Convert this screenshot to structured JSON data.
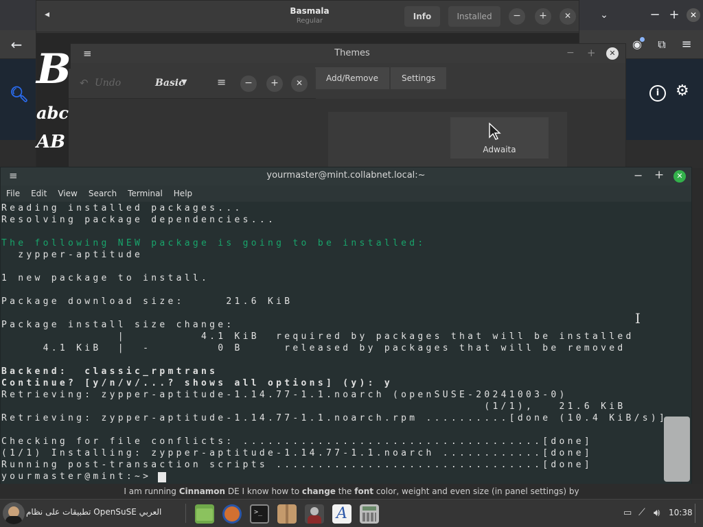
{
  "font_viewer": {
    "title": "Basmala",
    "subtitle": "Regular",
    "info_label": "Info",
    "installed_label": "Installed",
    "sample_big": "B",
    "sample_lower": "abcde",
    "sample_upper": "AB"
  },
  "themes": {
    "title": "Themes",
    "tabs": [
      "Add/Remove",
      "Settings"
    ],
    "theme_card": "Adwaita"
  },
  "mini": {
    "undo_label": "Undo",
    "mode_label": "Basic"
  },
  "terminal": {
    "title": "yourmaster@mint.collabnet.local:~",
    "menu": [
      "File",
      "Edit",
      "View",
      "Search",
      "Terminal",
      "Help"
    ],
    "lines": [
      "Reading installed packages...",
      "Resolving package dependencies...",
      "",
      "The following NEW package is going to be installed:",
      "  zypper-aptitude",
      "",
      "1 new package to install.",
      "",
      "Package download size:     21.6 KiB",
      "",
      "Package install size change:",
      "              |         4.1 KiB  required by packages that will be installed",
      "     4.1 KiB  |  -        0 B     released by packages that will be removed",
      "",
      "Backend:  classic_rpmtrans",
      "Continue? [y/n/v/...? shows all options] (y): y",
      "Retrieving: zypper-aptitude-1.14.77-1.1.noarch (openSUSE-20241003-0)",
      "                                                          (1/1),   21.6 KiB",
      "Retrieving: zypper-aptitude-1.14.77-1.1.noarch.rpm ..........[done (10.4 KiB/s)]",
      "",
      "Checking for file conflicts: ....................................[done]",
      "(1/1) Installing: zypper-aptitude-1.14.77-1.1.noarch ............[done]",
      "Running post-transaction scripts ................................[done]",
      "yourmaster@mint:~>"
    ]
  },
  "caption": {
    "t1": "I am running ",
    "t2": "Cinnamon",
    "t3": " DE I know how to ",
    "t4": "change",
    "t5": " the ",
    "t6": "font",
    "t7": " color, weight and even size (in panel settings) by"
  },
  "taskbar": {
    "menu_label": "تطبيقات على نظام OpenSuSE العربي",
    "clock": "10:38"
  },
  "colors": {
    "terminal_bg": "#263031",
    "accent_green": "#18a56b",
    "close_green": "#33b14b"
  }
}
